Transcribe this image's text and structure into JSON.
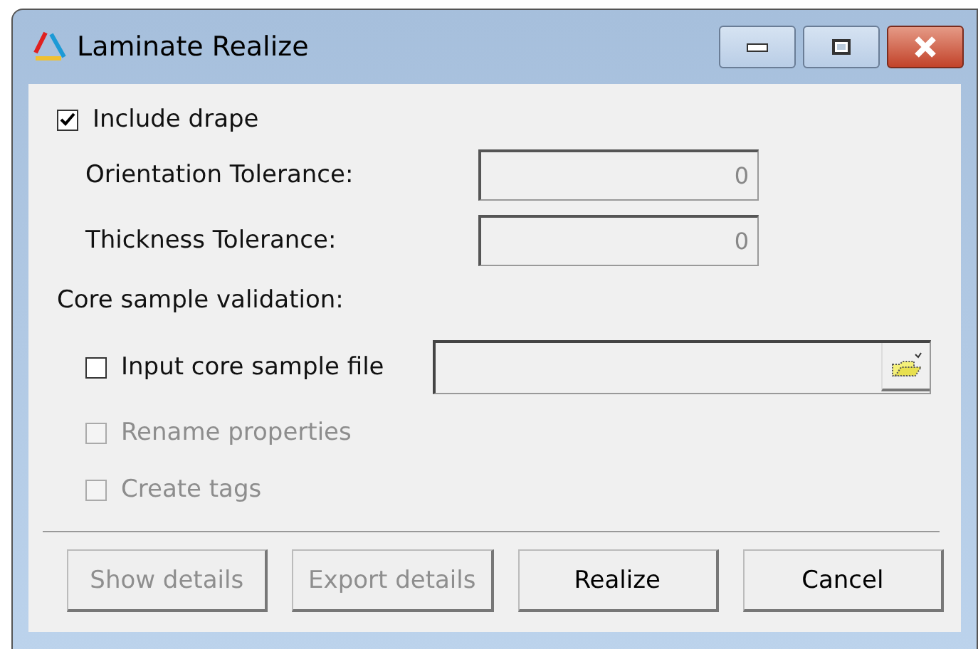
{
  "window": {
    "title": "Laminate Realize"
  },
  "include_drape": {
    "label": "Include drape",
    "checked": true
  },
  "tolerances": [
    {
      "label": "Orientation Tolerance:",
      "value": "0",
      "disabled": true
    },
    {
      "label": "Thickness Tolerance:",
      "value": "0",
      "disabled": true
    }
  ],
  "core_sample": {
    "heading": "Core sample validation:",
    "options": [
      {
        "kind": "file",
        "label": "Input core sample file",
        "checked": false,
        "disabled": false
      },
      {
        "kind": "check",
        "label": "Rename properties",
        "checked": false,
        "disabled": true
      },
      {
        "kind": "check",
        "label": "Create tags",
        "checked": false,
        "disabled": true
      }
    ]
  },
  "buttons": [
    {
      "label": "Show details",
      "disabled": true
    },
    {
      "label": "Export details",
      "disabled": true
    },
    {
      "label": "Realize",
      "disabled": false
    },
    {
      "label": "Cancel",
      "disabled": false
    }
  ]
}
